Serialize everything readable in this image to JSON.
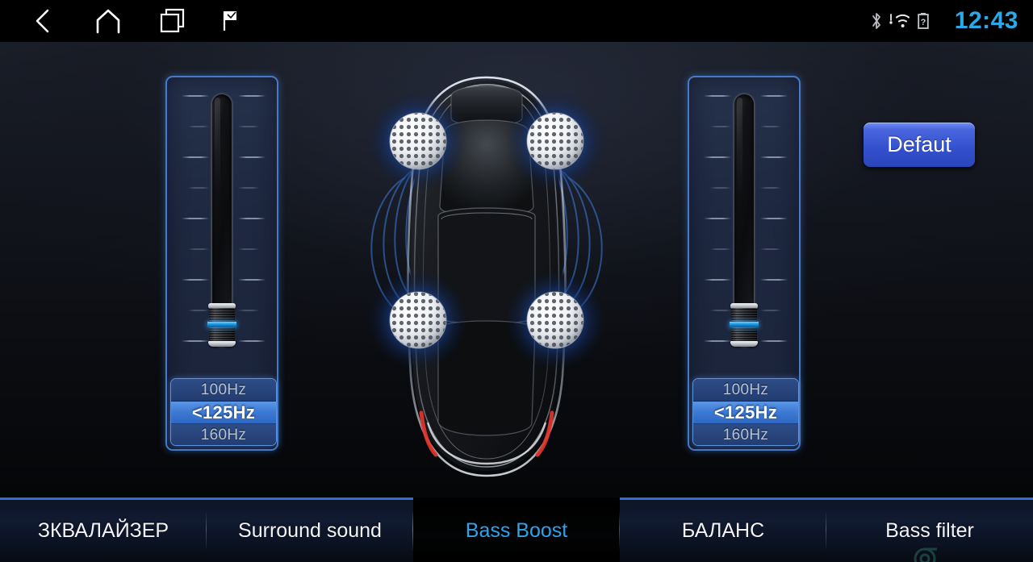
{
  "statusbar": {
    "nav": [
      {
        "name": "back-icon",
        "label": "Back"
      },
      {
        "name": "home-icon",
        "label": "Home"
      },
      {
        "name": "recents-icon",
        "label": "Recent apps"
      },
      {
        "name": "flag-icon",
        "label": "Flag"
      }
    ],
    "icons": [
      "bluetooth-icon",
      "wifi-icon",
      "battery-unknown-icon"
    ],
    "time": "12:43",
    "time_color": "#2aa8e8"
  },
  "controls": {
    "default_button": "Defaut",
    "left_slider": {
      "name": "left-bass-slider",
      "value_percent": 10,
      "frequencies": [
        {
          "label": "100Hz",
          "selected": false
        },
        {
          "label": "<125Hz",
          "selected": true
        },
        {
          "label": "160Hz",
          "selected": false
        }
      ]
    },
    "right_slider": {
      "name": "right-bass-slider",
      "value_percent": 10,
      "frequencies": [
        {
          "label": "100Hz",
          "selected": false
        },
        {
          "label": "<125Hz",
          "selected": true
        },
        {
          "label": "160Hz",
          "selected": false
        }
      ]
    }
  },
  "car_diagram": {
    "name": "car-speaker-diagram",
    "speakers": [
      {
        "name": "speaker-front-left",
        "position": "front-left"
      },
      {
        "name": "speaker-front-right",
        "position": "front-right"
      },
      {
        "name": "speaker-rear-left",
        "position": "rear-left"
      },
      {
        "name": "speaker-rear-right",
        "position": "rear-right"
      }
    ],
    "glow_color": "#1f52b0",
    "wave_color": "#3d7fe0"
  },
  "tabs": [
    {
      "label": "ЗКВАЛАЙЗЕР",
      "active": false
    },
    {
      "label": "Surround sound",
      "active": false
    },
    {
      "label": "Bass Boost",
      "active": true
    },
    {
      "label": "БАЛАНС",
      "active": false
    },
    {
      "label": "Bass filter",
      "active": false
    }
  ],
  "theme": {
    "accent": "#2da3ee",
    "panel_border": "#4679c6",
    "panel_fill": "#1e2840",
    "button_blue": "#3350cc"
  }
}
